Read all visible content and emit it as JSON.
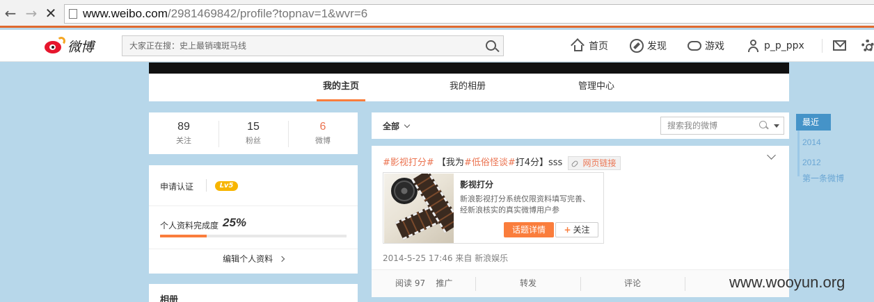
{
  "browser": {
    "url_host": "www.weibo.com",
    "url_path": "/2981469842/profile?topnav=1&wvr=6"
  },
  "header": {
    "logo_text": "微博",
    "search_placeholder": "大家正在搜：史上最销魂斑马线",
    "nav": [
      {
        "label": "首页",
        "icon": "home-icon"
      },
      {
        "label": "发现",
        "icon": "discover-icon"
      },
      {
        "label": "游戏",
        "icon": "game-icon"
      },
      {
        "label": "p_p_ppx",
        "icon": "user-icon"
      }
    ]
  },
  "profile_tabs": [
    {
      "label": "我的主页",
      "active": true
    },
    {
      "label": "我的相册",
      "active": false
    },
    {
      "label": "管理中心",
      "active": false
    }
  ],
  "stats": [
    {
      "value": "89",
      "label": "关注"
    },
    {
      "value": "15",
      "label": "粉丝"
    },
    {
      "value": "6",
      "label": "微博"
    }
  ],
  "info": {
    "verify_label": "申请认证",
    "level_badge": "Lv5",
    "completeness_label": "个人资料完成度",
    "completeness_value": "25%",
    "completeness_fraction": 0.25,
    "edit_profile": "编辑个人资料"
  },
  "album": {
    "title": "相册"
  },
  "feed": {
    "filter_label": "全部",
    "search_placeholder": "搜索我的微博"
  },
  "post": {
    "topic1": "#影视打分#",
    "text_a": " 【我为",
    "topic2": "#低俗怪谈#",
    "text_b": "打4分】sss",
    "link_label": "网页链接",
    "card_title": "影视打分",
    "card_desc": "新浪影视打分系统仅限资料填写完善、经新浪核实的真实微博用户参",
    "card_primary_button": "话题详情",
    "card_follow_button": "关注",
    "meta": "2014-5-25 17:46 来自 新浪娱乐",
    "actions": {
      "reads": "阅读 97",
      "promote": "推广",
      "forward": "转发",
      "comment": "评论"
    }
  },
  "timeline": {
    "active": "最近",
    "years": [
      "2014",
      "2012"
    ],
    "first": "第一条微博"
  },
  "watermark": "www.wooyun.org"
}
